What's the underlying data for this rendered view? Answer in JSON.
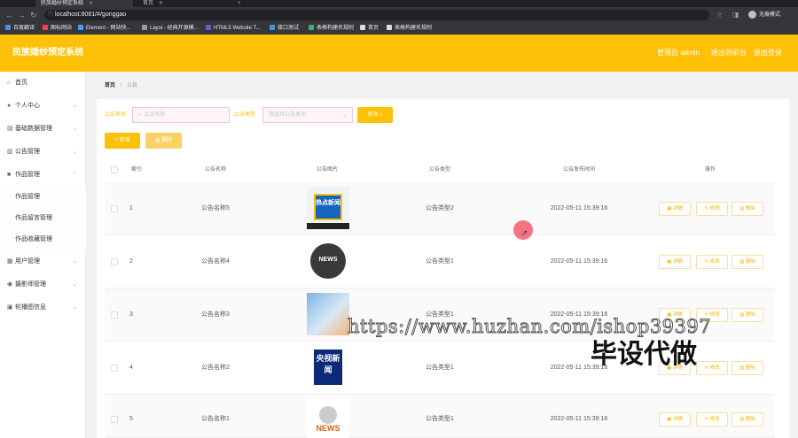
{
  "browser": {
    "tabs": [
      {
        "label": "民族婚纱预定系统",
        "active": true
      },
      {
        "label": "首页",
        "active": false
      }
    ],
    "url": "localhost:8081/#/gonggao",
    "profile": "无痕模式",
    "bookmarks": [
      "百度翻译",
      "图标网站",
      "Element - 网站快...",
      "Layui - 经典开源模...",
      "HTML5 Website T...",
      "接口测试",
      "表格构建名规则",
      "首页",
      "表格构建名规则"
    ]
  },
  "header": {
    "title": "民族婚纱预定系统",
    "admin": "管理员 admin",
    "logout_admin": "退出到前台",
    "logout": "退出登录",
    "bg_color": "#ffc107"
  },
  "sidebar": {
    "items": [
      {
        "label": "首页",
        "icon": "home-icon"
      },
      {
        "label": "个人中心",
        "icon": "user-icon"
      },
      {
        "label": "基础数据管理",
        "icon": "data-icon"
      },
      {
        "label": "公告管理",
        "icon": "notice-icon"
      },
      {
        "label": "作品管理",
        "icon": "works-icon"
      },
      {
        "label": "用户管理",
        "icon": "users-icon"
      },
      {
        "label": "摄影师管理",
        "icon": "camera-icon"
      },
      {
        "label": "轮播图信息",
        "icon": "carousel-icon"
      }
    ],
    "subitems": [
      "作品管理",
      "作品留言管理",
      "作品收藏管理"
    ]
  },
  "breadcrumb": {
    "home": "首页",
    "sep": "/",
    "current": "公告"
  },
  "search": {
    "name_label": "公告名称",
    "name_placeholder": "公告名称",
    "type_label": "公告类型",
    "type_placeholder": "请选择公告类型",
    "query_button": "查询"
  },
  "actions": {
    "add": "新增",
    "delete": "删除"
  },
  "table": {
    "columns": [
      "索引",
      "公告名称",
      "公告图片",
      "公告类型",
      "公告发布时间",
      "操作"
    ],
    "row_buttons": {
      "detail": "详情",
      "edit": "修改",
      "delete": "删除"
    },
    "rows": [
      {
        "index": "1",
        "name": "公告名称5",
        "image": "热点新闻",
        "type": "公告类型2",
        "time": "2022-05-11 15:39:16"
      },
      {
        "index": "2",
        "name": "公告名称4",
        "image": "NEWS",
        "type": "公告类型1",
        "time": "2022-05-11 15:39:16"
      },
      {
        "index": "3",
        "name": "公告名称3",
        "image": "",
        "type": "公告类型1",
        "time": "2022-05-11 15:39:16"
      },
      {
        "index": "4",
        "name": "公告名称2",
        "image": "央视新闻",
        "type": "公告类型1",
        "time": "2022-05-11 15:39:16"
      },
      {
        "index": "5",
        "name": "公告名称1",
        "image": "NEWS",
        "type": "公告类型1",
        "time": "2022-05-11 15:39:16"
      }
    ]
  },
  "watermark": {
    "url": "https://www.huzhan.com/ishop39397",
    "text": "毕设代做"
  }
}
